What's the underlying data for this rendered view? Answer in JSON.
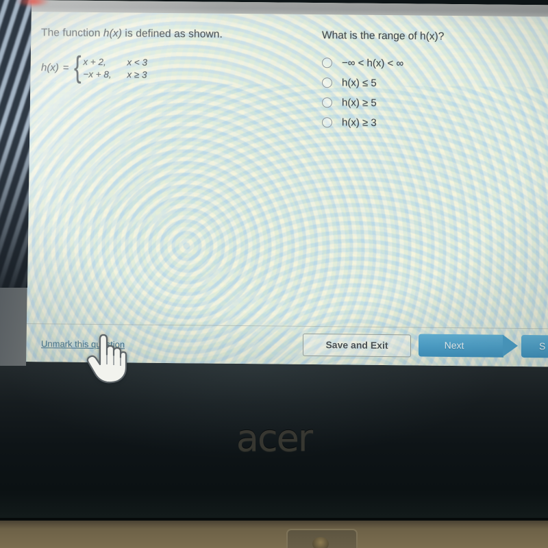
{
  "screen": {
    "left_panel": {
      "prompt_prefix": "The function ",
      "prompt_var": "h(x)",
      "prompt_suffix": " is defined as shown.",
      "function": {
        "lhs": "h(x)",
        "equals": "=",
        "brace": "{",
        "pieces": [
          {
            "expression": "x + 2,",
            "condition": "x < 3"
          },
          {
            "expression": "−x + 8,",
            "condition": "x ≥ 3"
          }
        ]
      }
    },
    "right_panel": {
      "question": "What is the range of h(x)?",
      "options": [
        {
          "label": "−∞ < h(x) < ∞",
          "selected": false
        },
        {
          "label": "h(x) ≤ 5",
          "selected": false
        },
        {
          "label": "h(x) ≥ 5",
          "selected": false
        },
        {
          "label": "h(x) ≥ 3",
          "selected": false
        }
      ]
    },
    "footer": {
      "unmark_link": "Unmark this question",
      "save_and_exit": "Save and Exit",
      "next": "Next",
      "submit_partial": "S"
    }
  },
  "device": {
    "brand_logo": "acer"
  },
  "colors": {
    "accent_blue": "#4ea4cf",
    "link_blue": "#45768f",
    "text": "#3e464a",
    "screen_bg": "#e9ecdf",
    "bezel": "#161c1f"
  }
}
